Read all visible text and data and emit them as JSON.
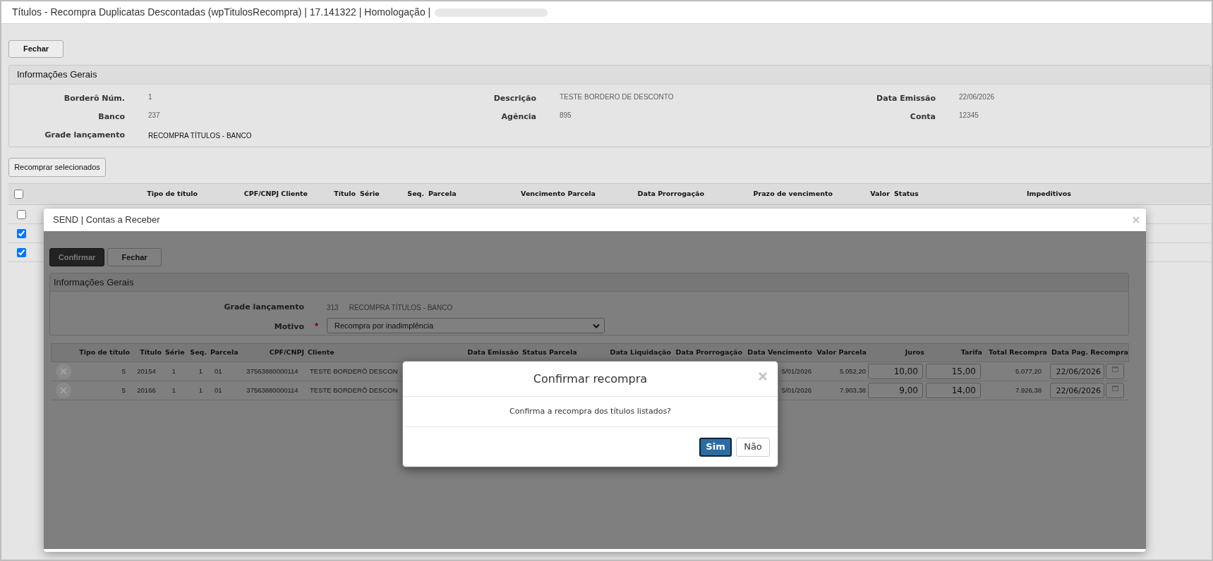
{
  "window": {
    "title": "Títulos - Recompra Duplicatas Descontadas (wpTitulosRecompra) | 17.141322 | Homologação |"
  },
  "toolbar": {
    "close_button": "Fechar"
  },
  "general_info": {
    "title": "Informações Gerais",
    "fields": [
      {
        "label": "Borderô Núm.",
        "value": "1",
        "kind": "readonly"
      },
      {
        "label": "Descrição",
        "value": "TESTE BORDERO DE DESCONTO",
        "kind": "readonly"
      },
      {
        "label": "Data Emissão",
        "value": "22/06/2026",
        "kind": "readonly"
      },
      {
        "label": "Banco",
        "value": "237",
        "kind": "readonly"
      },
      {
        "label": "Agência",
        "value": "895",
        "kind": "readonly"
      },
      {
        "label": "Conta",
        "value": "12345",
        "kind": "readonly"
      },
      {
        "label": "Grade lançamento",
        "value": "RECOMPRA TÍTULOS - BANCO",
        "kind": "text"
      }
    ]
  },
  "actions": {
    "repurchase_button": "Recomprar selecionados"
  },
  "titles_table": {
    "select_all": {
      "checked": false
    },
    "columns": [
      "Tipo de título",
      "CPF/CNPJ Cliente",
      "Título",
      "Série",
      "Seq.",
      "Parcela",
      "Vencimento Parcela",
      "Data Prorrogação",
      "Prazo de vencimento",
      "Valor",
      "Status",
      "Impeditivos"
    ],
    "rows": [
      {
        "checked": false
      },
      {
        "checked": true
      },
      {
        "checked": true
      }
    ]
  },
  "modal": {
    "title": "SEND | Contas a Receber",
    "buttons": [
      {
        "label": "Confirmar",
        "kind": "primary"
      },
      {
        "label": "Fechar",
        "kind": "default"
      }
    ],
    "panel": {
      "title": "Informações Gerais",
      "grade_label": "Grade lançamento",
      "grade_code": "313",
      "grade_name": "RECOMPRA TÍTULOS - BANCO",
      "motivo_label": "Motivo",
      "required_mark": "*",
      "motivo_value": "Recompra por inadimplência"
    },
    "table": {
      "columns": [
        "Tipo de título",
        "Título",
        "Série",
        "Seq.",
        "Parcela",
        "CPF/CNPJ",
        "Cliente",
        "Data Emissão",
        "Status Parcela",
        "Data Liquidação",
        "Data Prorrogação",
        "Data Vencimento",
        "Valor Parcela",
        "Juros",
        "Tarifa",
        "Total Recompra",
        "Data Pag. Recompra"
      ],
      "rows": [
        {
          "tipo": "5",
          "titulo": "20154",
          "serie": "1",
          "seq": "1",
          "parcela": "01",
          "cpf_cnpj": "37563880000114",
          "cliente": "TESTE BORDERÕ DESCON",
          "vencimento": "5/01/2026",
          "valor_parcela": "5.052,20",
          "juros": "10,00",
          "tarifa": "15,00",
          "total_recompra": "5.077,20",
          "data_pag": "22/06/2026"
        },
        {
          "tipo": "5",
          "titulo": "20166",
          "serie": "1",
          "seq": "1",
          "parcela": "01",
          "cpf_cnpj": "37563880000114",
          "cliente": "TESTE BORDERÕ DESCON",
          "vencimento": "5/01/2026",
          "valor_parcela": "7.903,38",
          "juros": "9,00",
          "tarifa": "14,00",
          "total_recompra": "7.926,38",
          "data_pag": "22/06/2026"
        }
      ]
    }
  },
  "confirm_dialog": {
    "title": "Confirmar recompra",
    "message": "Confirma a recompra dos títulos listados?",
    "buttons": [
      {
        "label": "Sim",
        "kind": "primary"
      },
      {
        "label": "Não",
        "kind": "default"
      }
    ]
  }
}
